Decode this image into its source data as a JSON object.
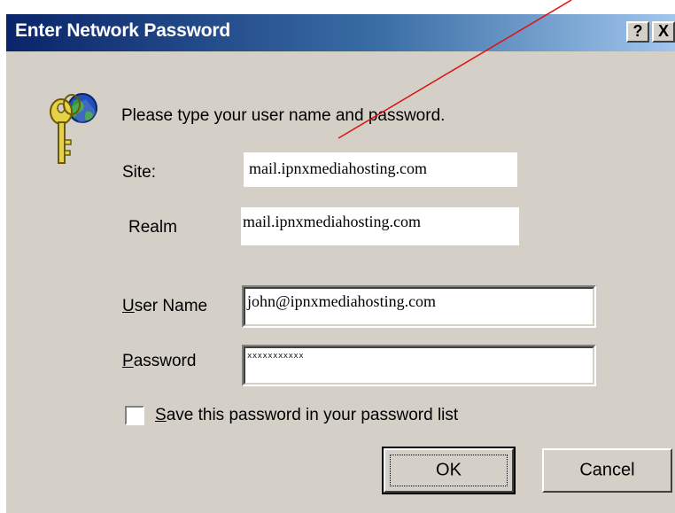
{
  "window": {
    "title": "Enter Network Password",
    "help_label": "?",
    "close_label": "X"
  },
  "prompt": "Please type your user name and password.",
  "site": {
    "label": "Site:",
    "value": "mail.ipnxmediahosting.com"
  },
  "realm": {
    "label": "Realm",
    "value": "mail.ipnxmediahosting.com"
  },
  "user_name": {
    "label_mnemonic": "U",
    "label_rest": "ser Name",
    "value": "john@ipnxmediahosting.com"
  },
  "password": {
    "label_mnemonic": "P",
    "label_rest": "assword",
    "value": "xxxxxxxxxxx"
  },
  "save_password": {
    "label_mnemonic": "S",
    "label_rest": "ave this password in your password list",
    "checked": false
  },
  "buttons": {
    "ok": "OK",
    "cancel": "Cancel"
  },
  "colors": {
    "dialog_face": "#d4d0c8",
    "title_start": "#0a246a",
    "title_end": "#a6caf0",
    "annotation": "#e01010"
  },
  "icons": {
    "keys": "keys-globe-icon"
  }
}
